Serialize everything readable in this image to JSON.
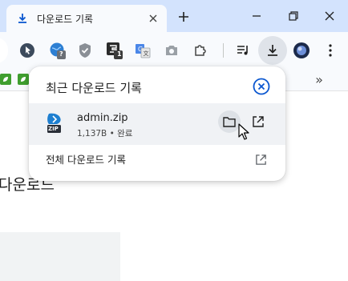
{
  "tab": {
    "title": "다운로드 기록",
    "favicon": "download-icon"
  },
  "toolbar": {
    "icons": [
      "cursor-extension-icon",
      "globe-extension-icon",
      "shield-extension-icon",
      "dark-extension-icon",
      "translate-extension-icon",
      "camera-extension-icon",
      "puzzle-extensions-icon",
      "media-control-icon",
      "download-icon",
      "profile-avatar-icon",
      "menu-dots-icon"
    ],
    "badges": {
      "globe": "?",
      "dark": "1"
    }
  },
  "bookmarks": {
    "more_label": "»"
  },
  "page": {
    "heading": "다운로드"
  },
  "bubble": {
    "title": "최근 다운로드 기록",
    "item": {
      "filename": "admin.zip",
      "status": "1,137B • 완료",
      "file_type_label": "ZIP"
    },
    "all_history_label": "전체 다운로드 기록"
  },
  "colors": {
    "accent": "#0b57d0",
    "tabstrip": "#d3e3fd",
    "toolbar": "#f8fafd"
  }
}
